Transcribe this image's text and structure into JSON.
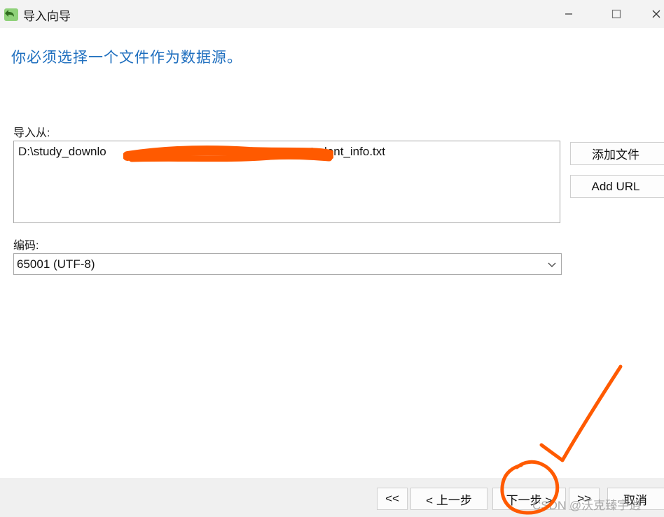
{
  "window": {
    "title": "导入向导",
    "app_icon": "import-wizard-icon",
    "controls": [
      "minimize-icon",
      "maximize-icon",
      "close-icon"
    ]
  },
  "heading": "你必须选择一个文件作为数据源。",
  "import_from": {
    "label": "导入从:",
    "file_path_start": "D:\\study_downlo",
    "file_path_end": "student_info.txt",
    "redaction_color": "#ff5a00"
  },
  "side_buttons": {
    "add_file": "添加文件",
    "add_url": "Add URL"
  },
  "encoding": {
    "label": "编码:",
    "value": "65001 (UTF-8)"
  },
  "nav": {
    "first": "<<",
    "prev": "< 上一步",
    "next": "下一步 >",
    "last": ">>",
    "cancel": "取消"
  },
  "watermark": "CSDN @沃克臻宇逍",
  "colors": {
    "accent": "#1f6fbf",
    "annotation": "#ff5a00"
  }
}
